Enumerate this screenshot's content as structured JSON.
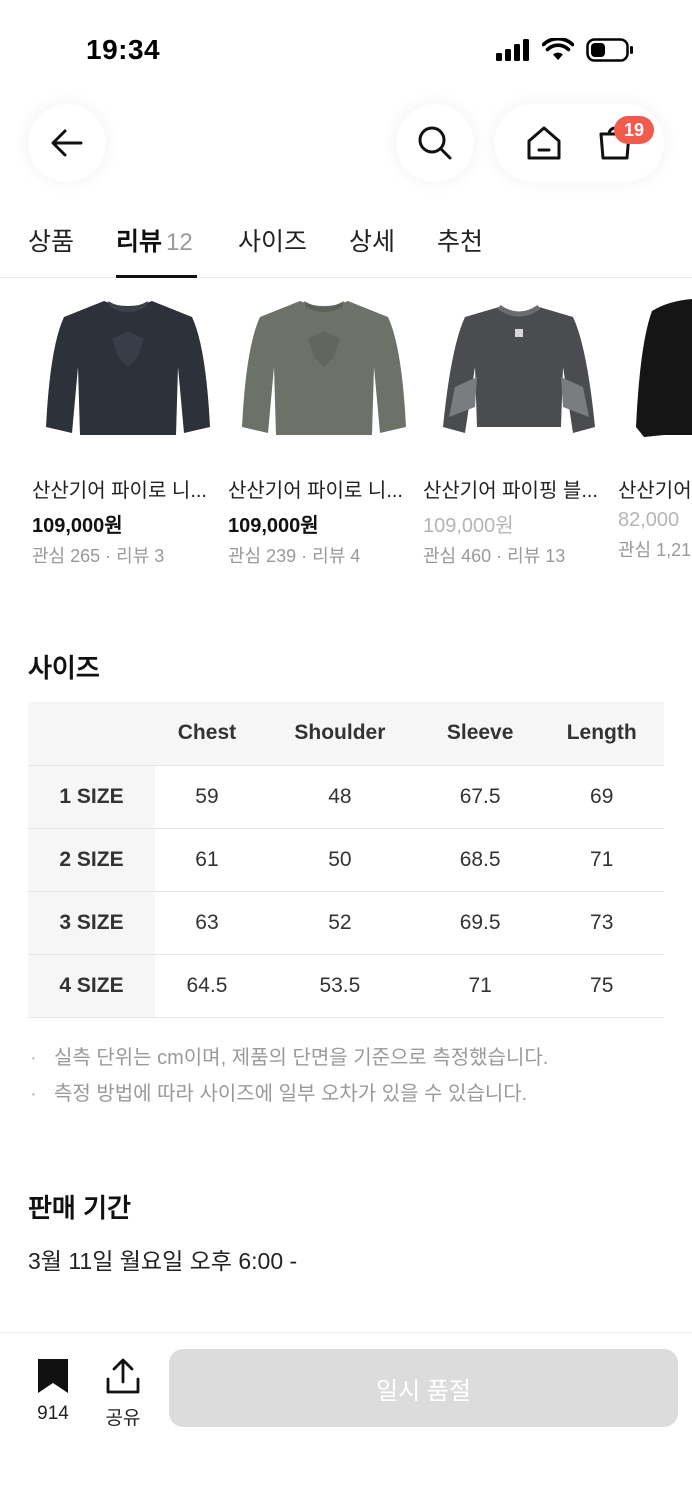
{
  "status": {
    "time": "19:34"
  },
  "nav": {
    "cart_count": "19"
  },
  "tabs": [
    {
      "label": "상품"
    },
    {
      "label": "리뷰",
      "count": "12"
    },
    {
      "label": "사이즈"
    },
    {
      "label": "상세"
    },
    {
      "label": "추천"
    }
  ],
  "products": [
    {
      "name": "산산기어 파이로 니...",
      "price": "109,000원",
      "meta": "관심 265 · 리뷰 3"
    },
    {
      "name": "산산기어 파이로 니...",
      "price": "109,000원",
      "meta": "관심 239 · 리뷰 4"
    },
    {
      "name": "산산기어 파이핑 블...",
      "price": "109,000원",
      "meta": "관심 460 · 리뷰 13"
    },
    {
      "name": "산산기어",
      "price": "82,000",
      "meta": "관심 1,21"
    }
  ],
  "size": {
    "title": "사이즈",
    "headers": [
      "",
      "Chest",
      "Shoulder",
      "Sleeve",
      "Length"
    ],
    "rows": [
      [
        "1 SIZE",
        "59",
        "48",
        "67.5",
        "69"
      ],
      [
        "2 SIZE",
        "61",
        "50",
        "68.5",
        "71"
      ],
      [
        "3 SIZE",
        "63",
        "52",
        "69.5",
        "73"
      ],
      [
        "4 SIZE",
        "64.5",
        "53.5",
        "71",
        "75"
      ]
    ],
    "notes": [
      "실측 단위는 cm이며, 제품의 단면을 기준으로 측정했습니다.",
      "측정 방법에 따라 사이즈에 일부 오차가 있을 수 있습니다."
    ]
  },
  "sale": {
    "title": "판매 기간",
    "value": "3월 11일 월요일 오후 6:00 -"
  },
  "bottom": {
    "bookmark_count": "914",
    "share_label": "공유",
    "soldout_label": "일시 품절"
  },
  "colors": {
    "badge": "#f15b4d",
    "soldout_bg": "#dcdcdc"
  }
}
